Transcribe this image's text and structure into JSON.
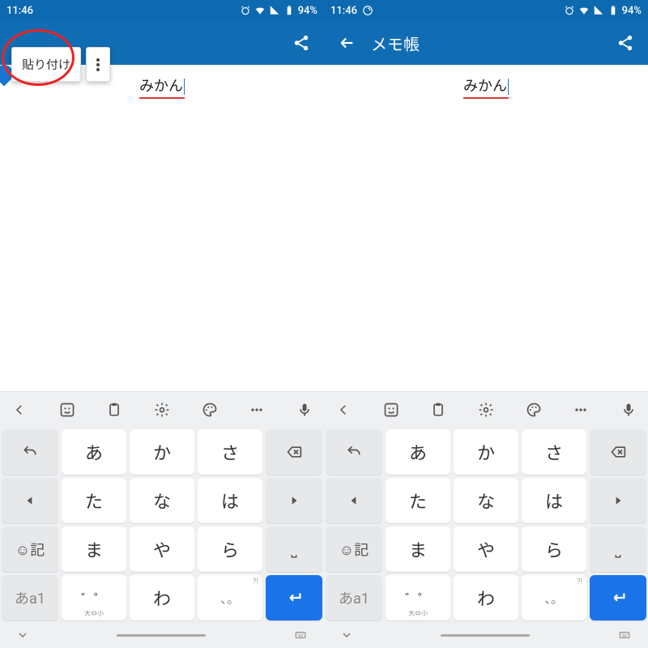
{
  "status": {
    "time": "11:46",
    "battery": "94%"
  },
  "left": {
    "ctx_paste": "貼り付け",
    "editor_text": "みかん"
  },
  "right": {
    "app_title": "メモ帳",
    "editor_text": "みかん"
  },
  "kb": {
    "rows": [
      [
        "reverse",
        "あ",
        "か",
        "さ",
        "backspace"
      ],
      [
        "left",
        "た",
        "な",
        "は",
        "right"
      ],
      [
        "emoji",
        "ま",
        "や",
        "ら",
        "space"
      ],
      [
        "mode",
        "small",
        "わ",
        "punct",
        "enter"
      ]
    ],
    "emoji_label": "☺記",
    "mode_label": "あa1",
    "small_label": "゛゜",
    "small_sub": "大⇔小",
    "punct_label": "、。",
    "punct_corner": "?!",
    "space_label": "⎵"
  }
}
